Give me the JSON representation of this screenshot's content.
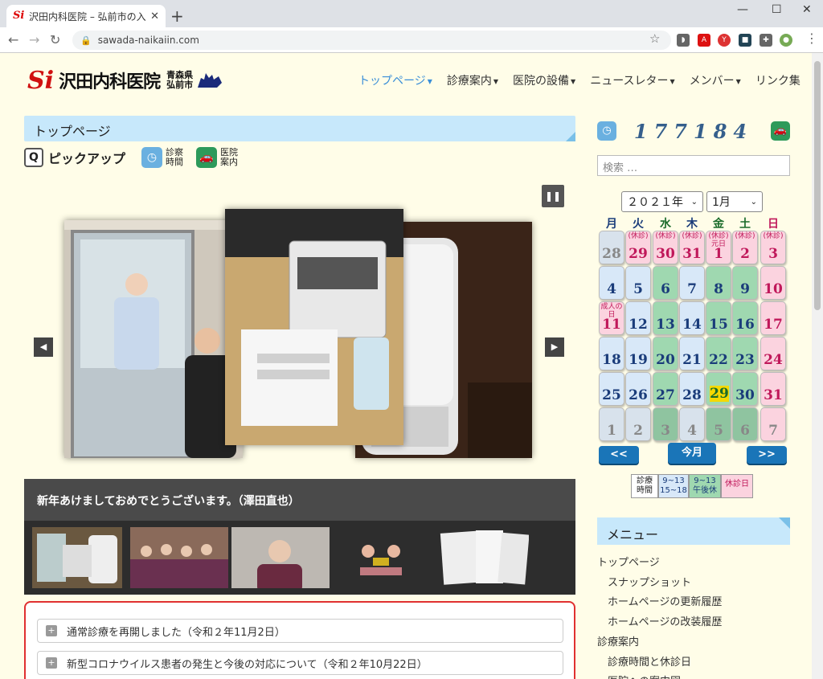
{
  "browser": {
    "tab_title": "沢田内科医院 – 弘前市の入院設備",
    "url": "sawada-naikaiin.com"
  },
  "site": {
    "logo_name": "沢田内科医院",
    "logo_pref1": "青森県",
    "logo_pref2": "弘前市"
  },
  "topnav": [
    {
      "label": "トップページ",
      "caret": true
    },
    {
      "label": "診療案内",
      "caret": true
    },
    {
      "label": "医院の設備",
      "caret": true
    },
    {
      "label": "ニュースレター",
      "caret": true
    },
    {
      "label": "メンバー",
      "caret": true
    },
    {
      "label": "リンク集",
      "caret": false
    }
  ],
  "main": {
    "section_title": "トップページ",
    "pickup_label": "ピックアップ",
    "quick_links": [
      {
        "line1": "診察",
        "line2": "時間"
      },
      {
        "line1": "医院",
        "line2": "案内"
      }
    ],
    "caption": "新年あけましておめでとうございます。（澤田直也）",
    "news": [
      "通常診療を再開しました（令和２年11月2日）",
      "新型コロナウイルス患者の発生と今後の対応について（令和２年10月22日）"
    ]
  },
  "sidebar": {
    "counter": "177184",
    "search_placeholder": "検索 …",
    "year": "２０２１年",
    "month": "1月",
    "weekdays": [
      "月",
      "火",
      "水",
      "木",
      "金",
      "土",
      "日"
    ],
    "weekday_colors": [
      "#1a3c7a",
      "#1a3c7a",
      "#1a6b2a",
      "#1a3c7a",
      "#1a6b2a",
      "#1a6b2a",
      "#c0185a"
    ],
    "calendar_weeks": [
      [
        {
          "d": "28",
          "t": "other"
        },
        {
          "d": "29",
          "t": "holiday",
          "note": "(休診)"
        },
        {
          "d": "30",
          "t": "holiday",
          "note": "(休診)"
        },
        {
          "d": "31",
          "t": "holiday",
          "note": "(休診)"
        },
        {
          "d": "1",
          "t": "holiday",
          "note": "(休診)\n元日"
        },
        {
          "d": "2",
          "t": "holiday",
          "note": "(休診)"
        },
        {
          "d": "3",
          "t": "holiday",
          "note": "(休診)"
        }
      ],
      [
        {
          "d": "4",
          "t": "normal"
        },
        {
          "d": "5",
          "t": "normal"
        },
        {
          "d": "6",
          "t": "half"
        },
        {
          "d": "7",
          "t": "normal"
        },
        {
          "d": "8",
          "t": "half"
        },
        {
          "d": "9",
          "t": "half"
        },
        {
          "d": "10",
          "t": "holiday"
        }
      ],
      [
        {
          "d": "11",
          "t": "holiday",
          "note": "成人の\n日"
        },
        {
          "d": "12",
          "t": "normal"
        },
        {
          "d": "13",
          "t": "half"
        },
        {
          "d": "14",
          "t": "normal"
        },
        {
          "d": "15",
          "t": "half"
        },
        {
          "d": "16",
          "t": "half"
        },
        {
          "d": "17",
          "t": "holiday"
        }
      ],
      [
        {
          "d": "18",
          "t": "normal"
        },
        {
          "d": "19",
          "t": "normal"
        },
        {
          "d": "20",
          "t": "half"
        },
        {
          "d": "21",
          "t": "normal"
        },
        {
          "d": "22",
          "t": "half"
        },
        {
          "d": "23",
          "t": "half"
        },
        {
          "d": "24",
          "t": "holiday"
        }
      ],
      [
        {
          "d": "25",
          "t": "normal"
        },
        {
          "d": "26",
          "t": "normal"
        },
        {
          "d": "27",
          "t": "half"
        },
        {
          "d": "28",
          "t": "normal"
        },
        {
          "d": "29",
          "t": "today"
        },
        {
          "d": "30",
          "t": "half"
        },
        {
          "d": "31",
          "t": "holiday"
        }
      ],
      [
        {
          "d": "1",
          "t": "other"
        },
        {
          "d": "2",
          "t": "other"
        },
        {
          "d": "3",
          "t": "other-half"
        },
        {
          "d": "4",
          "t": "other"
        },
        {
          "d": "5",
          "t": "other-half"
        },
        {
          "d": "6",
          "t": "other-half"
        },
        {
          "d": "7",
          "t": "other-holiday"
        }
      ]
    ],
    "prev": "<<",
    "today_btn": "今月",
    "next": ">>",
    "legend": [
      {
        "line1": "診療",
        "line2": "時間"
      },
      {
        "line1": "9~13",
        "line2": "15~18"
      },
      {
        "line1": "9~13",
        "line2": "午後休"
      },
      {
        "line1": "休診日",
        "line2": ""
      }
    ],
    "menu_title": "メニュー",
    "menu_items": [
      {
        "label": "トップページ",
        "indent": 0
      },
      {
        "label": "スナップショット",
        "indent": 1
      },
      {
        "label": "ホームページの更新履歴",
        "indent": 1
      },
      {
        "label": "ホームページの改装履歴",
        "indent": 1
      },
      {
        "label": "診療案内",
        "indent": 0
      },
      {
        "label": "診療時間と休診日",
        "indent": 1
      },
      {
        "label": "医院への案内図",
        "indent": 1
      }
    ]
  },
  "colors": {
    "accent": "#3a8ed8",
    "section_bg": "#c7e8fb",
    "page_bg": "#fffde8",
    "holiday": "#fbd3df",
    "half": "#9fd8b0",
    "normal": "#d8e8f8",
    "today": "#f5d800"
  }
}
